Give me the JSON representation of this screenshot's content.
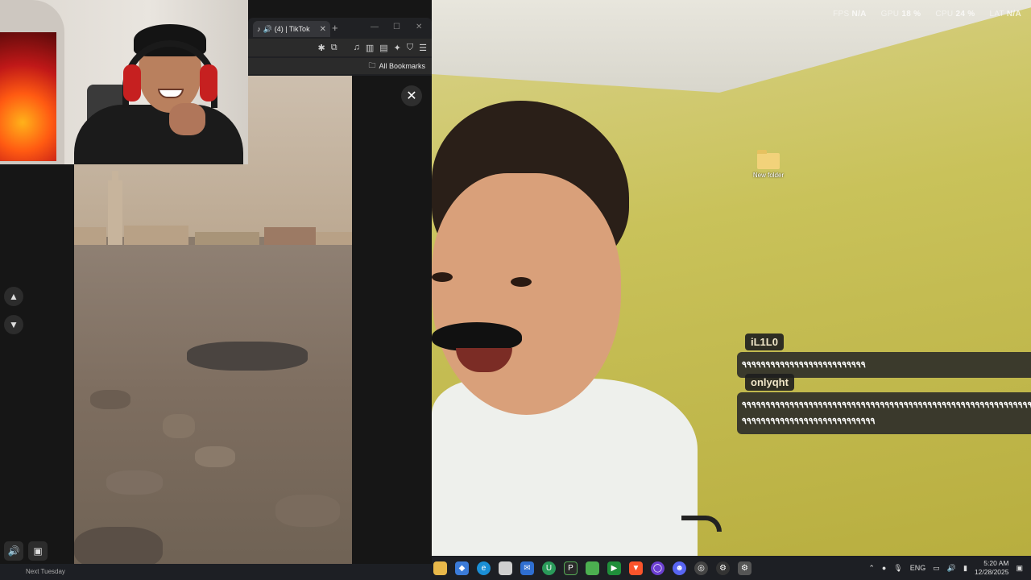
{
  "stats": {
    "fps_label": "FPS",
    "fps_value": "N/A",
    "gpu_label": "GPU",
    "gpu_value": "18 %",
    "cpu_label": "CPU",
    "cpu_value": "24 %",
    "lat_label": "LAT",
    "lat_value": "N/A"
  },
  "desktop": {
    "folder_label": "New folder"
  },
  "chat": [
    {
      "user": "iL1L0",
      "lines": [
        "٩٩٩٩٩٩٩٩٩٩٩٩٩٩٩٩٩٩٩٩٩٩٩٩٩٩"
      ]
    },
    {
      "user": "onlyqht",
      "lines": [
        "٩٩٩٩٩٩٩٩٩٩٩٩٩٩٩٩٩٩٩٩٩٩٩٩٩٩٩٩٩٩٩٩٩٩٩٩٩٩٩٩٩٩٩٩٩٩٩٩٩٩٩٩٩٩٩٩٩٩٩٩٩٩٩٩٩٩٩٩٩٩٩٩٩٩٩٩٩٩",
        "٩٩٩٩٩٩٩٩٩٩٩٩٩٩٩٩٩٩٩٩٩٩٩٩٩٩٩٩"
      ]
    }
  ],
  "browser": {
    "tab_title": "(4) | TikTok",
    "new_tab": "+",
    "bookmarks_label": "All Bookmarks"
  },
  "video": {
    "caption": ""
  },
  "nav": {
    "up": "▲",
    "down": "▼",
    "close": "✕"
  },
  "taskbar": {
    "language": "ENG",
    "time": "5:20 AM",
    "date": "12/28/2025",
    "calendar_hint": "Next Tuesday"
  },
  "colors": {
    "chat_bg": "#282828",
    "desktop_wall": "#c9c25a",
    "taskbar": "#1d1f24"
  }
}
